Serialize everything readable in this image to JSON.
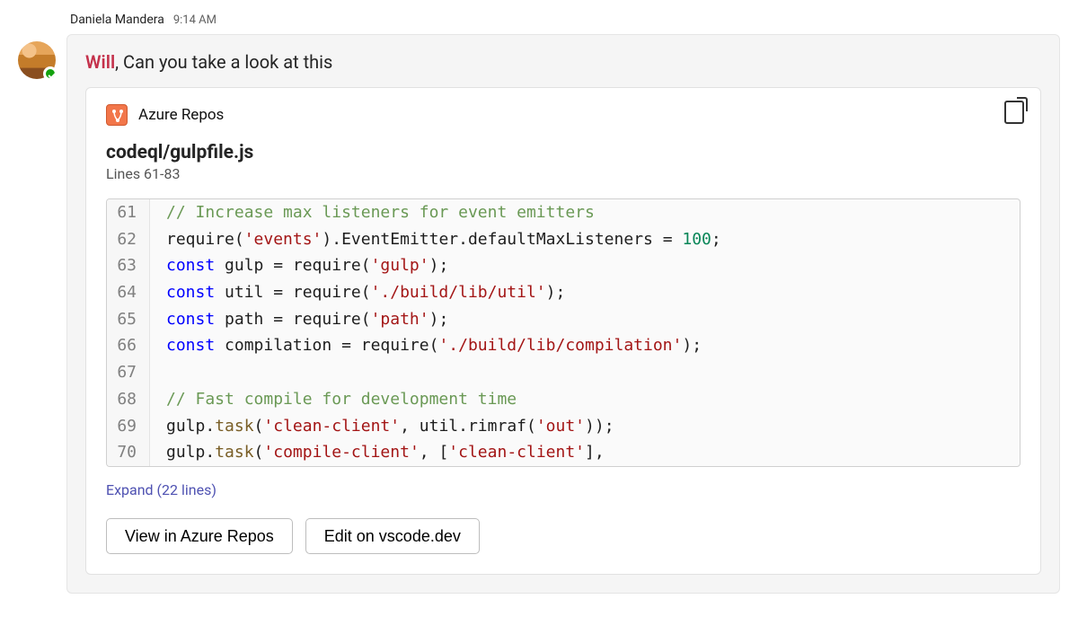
{
  "sender_name": "Daniela Mandera",
  "timestamp": "9:14 AM",
  "message": {
    "mention": "Will",
    "text": ", Can you take a look at this"
  },
  "card": {
    "source_name": "Azure Repos",
    "file_title": "codeql/gulpfile.js",
    "lines_subtitle": "Lines 61-83",
    "expand_text": "Expand (22 lines)",
    "buttons": {
      "view": "View in Azure Repos",
      "edit": "Edit on vscode.dev"
    },
    "code": [
      {
        "ln": "61",
        "segs": [
          {
            "t": "// Increase max listeners for event emitters",
            "c": "tok-comment"
          }
        ]
      },
      {
        "ln": "62",
        "segs": [
          {
            "t": "require("
          },
          {
            "t": "'events'",
            "c": "tok-string"
          },
          {
            "t": ").EventEmitter.defaultMaxListeners = "
          },
          {
            "t": "100",
            "c": "tok-number"
          },
          {
            "t": ";"
          }
        ]
      },
      {
        "ln": "63",
        "segs": [
          {
            "t": "const",
            "c": "tok-keyword"
          },
          {
            "t": " gulp = require("
          },
          {
            "t": "'gulp'",
            "c": "tok-string"
          },
          {
            "t": ");"
          }
        ]
      },
      {
        "ln": "64",
        "segs": [
          {
            "t": "const",
            "c": "tok-keyword"
          },
          {
            "t": " util = require("
          },
          {
            "t": "'./build/lib/util'",
            "c": "tok-string"
          },
          {
            "t": ");"
          }
        ]
      },
      {
        "ln": "65",
        "segs": [
          {
            "t": "const",
            "c": "tok-keyword"
          },
          {
            "t": " path = require("
          },
          {
            "t": "'path'",
            "c": "tok-string"
          },
          {
            "t": ");"
          }
        ]
      },
      {
        "ln": "66",
        "segs": [
          {
            "t": "const",
            "c": "tok-keyword"
          },
          {
            "t": " compilation = require("
          },
          {
            "t": "'./build/lib/compilation'",
            "c": "tok-string"
          },
          {
            "t": ");"
          }
        ]
      },
      {
        "ln": "67",
        "segs": [
          {
            "t": " "
          }
        ]
      },
      {
        "ln": "68",
        "segs": [
          {
            "t": "// Fast compile for development time",
            "c": "tok-comment"
          }
        ]
      },
      {
        "ln": "69",
        "segs": [
          {
            "t": "gulp."
          },
          {
            "t": "task",
            "c": "tok-method"
          },
          {
            "t": "("
          },
          {
            "t": "'clean-client'",
            "c": "tok-string"
          },
          {
            "t": ", util.rimraf("
          },
          {
            "t": "'out'",
            "c": "tok-string"
          },
          {
            "t": "));"
          }
        ]
      },
      {
        "ln": "70",
        "segs": [
          {
            "t": "gulp."
          },
          {
            "t": "task",
            "c": "tok-method"
          },
          {
            "t": "("
          },
          {
            "t": "'compile-client'",
            "c": "tok-string"
          },
          {
            "t": ", ["
          },
          {
            "t": "'clean-client'",
            "c": "tok-string"
          },
          {
            "t": "],"
          }
        ]
      }
    ]
  }
}
